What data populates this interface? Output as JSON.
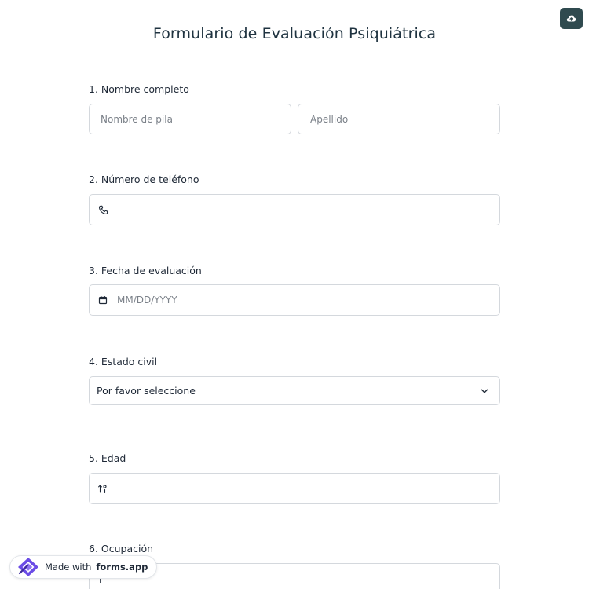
{
  "header": {
    "title": "Formulario de Evaluación Psiquiátrica"
  },
  "questions": {
    "q1": {
      "label": "1. Nombre completo",
      "first_name_placeholder": "Nombre de pila",
      "last_name_placeholder": "Apellido"
    },
    "q2": {
      "label": "2. Número de teléfono",
      "icon": "phone-icon"
    },
    "q3": {
      "label": "3. Fecha de evaluación",
      "placeholder": "MM/DD/YYYY",
      "icon": "calendar-icon"
    },
    "q4": {
      "label": "4. Estado civil",
      "selected": "Por favor seleccione",
      "icon": "chevron-down-icon"
    },
    "q5": {
      "label": "5. Edad",
      "icon": "number-sort-icon"
    },
    "q6": {
      "label": "6. Ocupación",
      "value": "I"
    }
  },
  "badge": {
    "prefix": "Made with",
    "brand": "forms.app"
  },
  "colors": {
    "save_button": "#2f4a4f",
    "brand_purple": "#6b4ce6",
    "border": "#d4d8dd"
  }
}
